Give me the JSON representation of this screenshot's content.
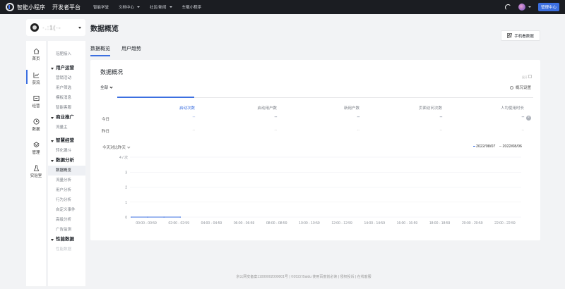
{
  "topbar": {
    "logo_text": "智能小程序",
    "dev_title": "开发者平台",
    "nav": [
      {
        "label": "智能学堂",
        "has_caret": false
      },
      {
        "label": "文档中心",
        "has_caret": true
      },
      {
        "label": "社区/新闻",
        "has_caret": true
      },
      {
        "label": "车载小程序",
        "has_caret": false
      }
    ],
    "manage_label": "管理中心"
  },
  "app": {
    "name": "·.:1(·-"
  },
  "rail": [
    {
      "label": "首页",
      "icon": "home-icon"
    },
    {
      "label": "获流",
      "icon": "chart-icon"
    },
    {
      "label": "经营",
      "icon": "store-icon"
    },
    {
      "label": "数据",
      "icon": "clock-icon"
    },
    {
      "label": "管理",
      "icon": "layers-icon"
    },
    {
      "label": "实验室",
      "icon": "flask-icon"
    }
  ],
  "subnav": {
    "top_item": "冠肥接入",
    "groups": [
      {
        "label": "用户运营",
        "items": [
          "营销活动",
          "用户筛选",
          "模板消息",
          "智能客服"
        ]
      },
      {
        "label": "商业推广",
        "items": [
          "流量主"
        ]
      },
      {
        "label": "智慧经营",
        "items": [
          "转化漏斗"
        ]
      },
      {
        "label": "数据分析",
        "items": [
          "数据概览",
          "流量分析",
          "用户分析",
          "行为分析",
          "自定义事件",
          "高级分析",
          "广告监测"
        ]
      },
      {
        "label": "性能数据",
        "items": [
          "性能数据"
        ]
      }
    ]
  },
  "page": {
    "title": "数据概览",
    "mobile_btn": "手机看数据",
    "tabs": [
      "数据概览",
      "用户趋势"
    ]
  },
  "overview": {
    "title": "数据概况",
    "collapse": "展开",
    "filter": "全部",
    "settings": "概况设置",
    "metrics": [
      "启动次数",
      "启动用户数",
      "新用户数",
      "页面访问次数",
      "人均使用时长"
    ],
    "today_label": "今日",
    "yesterday_label": "昨日",
    "today_values": [
      "--",
      "--",
      "--",
      "--",
      "--"
    ],
    "yesterday_values": [
      "--",
      "--",
      "--",
      "--",
      "--"
    ]
  },
  "compare": {
    "label": "今天对比昨天",
    "legend": [
      "2022/08/07",
      "2022/08/06"
    ]
  },
  "chart_data": {
    "type": "line",
    "xlabel": "",
    "ylabel": "",
    "y_unit": "4 / 次",
    "ylim": [
      0,
      4
    ],
    "y_ticks": [
      "0",
      "1",
      "2",
      "3"
    ],
    "categories": [
      "00:00 - 00:59",
      "02:00 - 02:59",
      "04:00 - 04:59",
      "06:00 - 06:59",
      "08:00 - 08:59",
      "10:00 - 10:59",
      "12:00 - 12:59",
      "14:00 - 14:59",
      "16:00 - 16:59",
      "18:00 - 18:59",
      "20:00 - 20:59",
      "22:00 - 22:59"
    ],
    "series": [
      {
        "name": "2022/08/07",
        "values": [
          0,
          0,
          0,
          0
        ]
      },
      {
        "name": "2022/08/06",
        "values": []
      }
    ]
  },
  "footer": "京公网安备案11000002000001号 | ©2022 Baidu 使用百度前必读 | 侵权投诉 | 在线客服",
  "colors": {
    "accent": "#3c6fe0",
    "topbar": "#1b1d22",
    "background": "#f2f3f5"
  }
}
